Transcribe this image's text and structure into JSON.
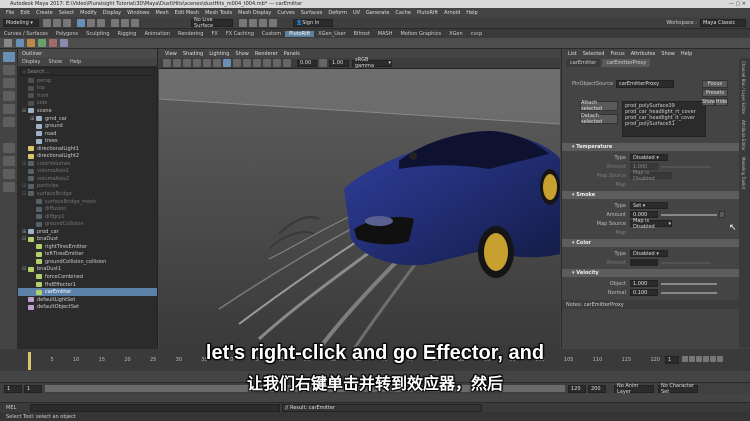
{
  "window": {
    "title": "Autodesk Maya 2017: E:\\Video\\Pluralsight Tutorial\\3D\\Maya\\Dust\\Hits\\scenes\\dustHits_m004_t004.mb* --- carEmitter"
  },
  "menubar": [
    "File",
    "Edit",
    "Create",
    "Select",
    "Modify",
    "Display",
    "Windows",
    "Mesh",
    "Edit Mesh",
    "Mesh Tools",
    "Mesh Display",
    "Curves",
    "Surfaces",
    "Deform",
    "UV",
    "Generate",
    "Cache",
    "PlutoRift",
    "Arnold",
    "Help"
  ],
  "status": {
    "mode": "Modeling",
    "live_surface": "No Live Surface",
    "sign_in": "Sign In",
    "workspace_label": "Workspace :",
    "workspace_value": "Maya Classic"
  },
  "shelf_tabs": [
    "Curves / Surfaces",
    "Polygons",
    "Sculpting",
    "Rigging",
    "Animation",
    "Rendering",
    "FX",
    "FX Caching",
    "Custom",
    "PlutoRift",
    "XGen_User",
    "Bifrost",
    "MASH",
    "Motion Graphics",
    "XGen",
    "cvcp"
  ],
  "shelf_active": "PlutoRift",
  "outliner": {
    "title": "Outliner",
    "menus": [
      "Display",
      "Show",
      "Help"
    ],
    "search_placeholder": "Search...",
    "items": [
      {
        "label": "persp",
        "depth": 0,
        "color": "#7a7a7a",
        "dim": true
      },
      {
        "label": "top",
        "depth": 0,
        "color": "#7a7a7a",
        "dim": true
      },
      {
        "label": "front",
        "depth": 0,
        "color": "#7a7a7a",
        "dim": true
      },
      {
        "label": "side",
        "depth": 0,
        "color": "#7a7a7a",
        "dim": true
      },
      {
        "label": "scene",
        "depth": 0,
        "color": "#9fb3c8",
        "exp": "-"
      },
      {
        "label": "grnd_car",
        "depth": 1,
        "color": "#9fb3c8",
        "exp": "+"
      },
      {
        "label": "ground",
        "depth": 1,
        "color": "#9fb3c8"
      },
      {
        "label": "road",
        "depth": 1,
        "color": "#9fb3c8"
      },
      {
        "label": "trees",
        "depth": 1,
        "color": "#9fb3c8"
      },
      {
        "label": "directionalLight1",
        "depth": 0,
        "color": "#d8c66a"
      },
      {
        "label": "directionalLight2",
        "depth": 0,
        "color": "#d8c66a"
      },
      {
        "label": "colorVolumes",
        "depth": 0,
        "color": "#8aa0b0",
        "exp": "+",
        "dim": true
      },
      {
        "label": "volumeAxis1",
        "depth": 0,
        "color": "#8aa0b0",
        "dim": true
      },
      {
        "label": "volumeAxis2",
        "depth": 0,
        "color": "#8aa0b0",
        "dim": true
      },
      {
        "label": "particles",
        "depth": 0,
        "color": "#8aa0b0",
        "exp": "+",
        "dim": true
      },
      {
        "label": "surfaceBridge",
        "depth": 0,
        "color": "#8aa0b0",
        "exp": "-",
        "dim": true
      },
      {
        "label": "surfaceBridge_mesh",
        "depth": 1,
        "color": "#8aa0b0",
        "dim": true
      },
      {
        "label": "diffusion",
        "depth": 1,
        "color": "#8aa0b0",
        "dim": true
      },
      {
        "label": "diffgrp1",
        "depth": 1,
        "color": "#8aa0b0",
        "dim": true
      },
      {
        "label": "groundCollision",
        "depth": 1,
        "color": "#8aa0b0",
        "dim": true
      },
      {
        "label": "prod_car",
        "depth": 0,
        "color": "#9fb3c8",
        "exp": "+"
      },
      {
        "label": "bnaDust",
        "depth": 0,
        "color": "#b4d06a",
        "exp": "-"
      },
      {
        "label": "rightTiresEmitter",
        "depth": 1,
        "color": "#b4d06a"
      },
      {
        "label": "leftTiresEmitter",
        "depth": 1,
        "color": "#b4d06a"
      },
      {
        "label": "groundCollision_collision",
        "depth": 1,
        "color": "#b4d06a"
      },
      {
        "label": "bnaDust1",
        "depth": 0,
        "color": "#b4d06a",
        "exp": "-"
      },
      {
        "label": "forceCombined",
        "depth": 1,
        "color": "#b4d06a"
      },
      {
        "label": "fhdEffector1",
        "depth": 1,
        "color": "#b4d06a"
      },
      {
        "label": "carEmitter",
        "depth": 1,
        "color": "#b4d06a",
        "sel": true
      },
      {
        "label": "defaultLightSet",
        "depth": 0,
        "color": "#c0a0d0"
      },
      {
        "label": "defaultObjectSet",
        "depth": 0,
        "color": "#c0a0d0"
      }
    ]
  },
  "viewport": {
    "menus": [
      "View",
      "Shading",
      "Lighting",
      "Show",
      "Renderer",
      "Panels"
    ],
    "gamma": "sRGB gamma",
    "field_a": "0.00",
    "field_b": "1.00"
  },
  "channel_box": {
    "menus": [
      "List",
      "Selected",
      "Focus",
      "Attributes",
      "Show",
      "Help"
    ],
    "tabs": [
      "carEmitter",
      "carEmitterProxy"
    ],
    "active_tab": "carEmitterProxy",
    "proxy_label": "PlnObjectSource",
    "proxy_value": "carEmitterProxy",
    "focus_btn": "Focus",
    "presets_btn": "Presets",
    "show_btn": "Show",
    "hide_btn": "Hide",
    "attach_btn": "Attach selected",
    "detach_btn": "Detach selected",
    "sources": [
      "prod_polySurface39",
      "prod_car_headlight_rt_cover",
      "prod_car_headlight_lt_cover",
      "prod_polySurface51"
    ],
    "sections": {
      "temperature": {
        "title": "Temperature",
        "type_label": "Type",
        "type_value": "Disabled",
        "amount_label": "Amount",
        "amount_value": "1.000",
        "map_label": "Map Source",
        "map_value": "Map is Disabled",
        "map_note": "Map"
      },
      "smoke": {
        "title": "Smoke",
        "type_label": "Type",
        "type_value": "Set",
        "amount_label": "Amount",
        "amount_value": "0.000",
        "map_label": "Map Source",
        "map_value": "Map is Disabled",
        "map_note": "Map"
      },
      "color": {
        "title": "Color",
        "type_label": "Type",
        "type_value": "Disabled",
        "amount_label": "Amount"
      },
      "velocity": {
        "title": "Velocity",
        "object_label": "Object",
        "object_value": "1.000",
        "normal_label": "Normal",
        "normal_value": "0.100"
      }
    },
    "notes_label": "Notes: carEmitterProxy",
    "bottom_buttons": [
      "Select",
      "Load Attributes",
      "Copy Tab"
    ],
    "side_tabs": [
      "Channel Box / Layer Editor",
      "Attribute Editor",
      "Modeling Toolkit"
    ]
  },
  "timeline": {
    "ticks": [
      "1",
      "5",
      "10",
      "15",
      "20",
      "25",
      "30",
      "35",
      "40",
      "45",
      "50",
      "55",
      "60",
      "65",
      "70",
      "75",
      "80",
      "85",
      "90",
      "95",
      "100",
      "105",
      "110",
      "115",
      "120"
    ],
    "current_frame": "1",
    "range_start": "1",
    "range_inner_start": "1",
    "range_inner_end": "120",
    "range_end": "200",
    "range_field": "120",
    "range_max": "200",
    "anim_layer": "No Anim Layer",
    "char_set": "No Character Set"
  },
  "command": {
    "lang": "MEL",
    "result": "// Result: carEmitter"
  },
  "helpline": "Select Tool: select an object",
  "subtitles": {
    "en": "let's right-click and go Effector, and",
    "zh": "让我们右键单击并转到效应器，然后"
  },
  "colors": {
    "selection": "#5c82aa",
    "car_body": "#1f2a6b",
    "wheels": "#c8a030"
  }
}
